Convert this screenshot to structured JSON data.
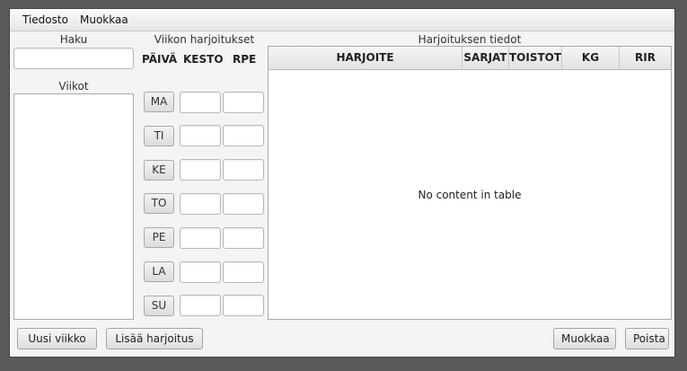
{
  "menu": {
    "file": "Tiedosto",
    "edit": "Muokkaa"
  },
  "search": {
    "label": "Haku",
    "value": "",
    "placeholder": ""
  },
  "weeks": {
    "label": "Viikot",
    "items": []
  },
  "weekly": {
    "title": "Viikon harjoitukset",
    "col_day": "PÄIVÄ",
    "col_duration": "KESTO",
    "col_rpe": "RPE",
    "days": [
      {
        "label": "MA",
        "duration": "",
        "rpe": ""
      },
      {
        "label": "TI",
        "duration": "",
        "rpe": ""
      },
      {
        "label": "KE",
        "duration": "",
        "rpe": ""
      },
      {
        "label": "TO",
        "duration": "",
        "rpe": ""
      },
      {
        "label": "PE",
        "duration": "",
        "rpe": ""
      },
      {
        "label": "LA",
        "duration": "",
        "rpe": ""
      },
      {
        "label": "SU",
        "duration": "",
        "rpe": ""
      }
    ]
  },
  "details": {
    "title": "Harjoituksen tiedot",
    "columns": [
      "HARJOITE",
      "SARJAT",
      "TOISTOT",
      "KG",
      "RIR"
    ],
    "empty_text": "No content in table"
  },
  "buttons": {
    "new_week": "Uusi viikko",
    "add_exercise": "Lisää harjoitus",
    "edit": "Muokkaa",
    "delete": "Poista"
  }
}
